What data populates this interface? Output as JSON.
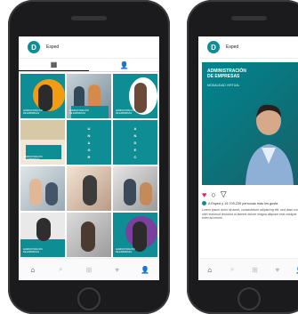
{
  "profile": {
    "logo_letter": "D",
    "username": "Esped"
  },
  "tabs": [
    {
      "icon": "grid-icon",
      "active": true
    },
    {
      "icon": "tagged-user-icon",
      "active": false
    }
  ],
  "grid": {
    "caption": "ADMINISTRACIÓN\nDE EMPRESAS",
    "vertical_text": [
      "U",
      "N",
      "A",
      "G",
      "R",
      "A",
      "N",
      "D",
      "E",
      "C",
      "I",
      "S",
      "I",
      "Ó",
      "N"
    ]
  },
  "post": {
    "title": "ADMINISTRACIÓN\nDE EMPRESAS",
    "subtitle": "MODALIDAD VIRTUAL",
    "likes_text": "A Esped y 19.709.239 personas más les gusta",
    "description": "Lorem ipsum dolor sit amet, consectetuer adipiscing elit, sed diam nonummy nibh euismod tincidunt ut laoreet dolore magna aliquam erat volutpat. Ut wisi enim ad minim"
  },
  "nav": [
    "home-icon",
    "search-icon",
    "add-icon",
    "heart-icon",
    "profile-icon"
  ],
  "colors": {
    "teal": "#0e8d94",
    "orange": "#f39c12",
    "purple": "#7b3f9e"
  }
}
